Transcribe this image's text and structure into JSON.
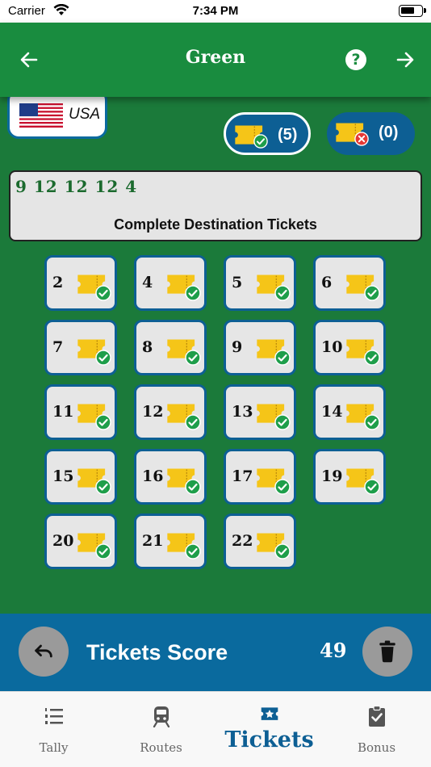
{
  "status_bar": {
    "carrier": "Carrier",
    "time": "7:34 PM"
  },
  "header": {
    "title": "Green"
  },
  "country": {
    "name": "USA"
  },
  "counts": {
    "completed": "(5)",
    "failed": "(0)"
  },
  "summary": {
    "sequence": "9  12  12  12  4",
    "caption": "Complete Destination Tickets"
  },
  "tickets": [
    "2",
    "4",
    "5",
    "6",
    "7",
    "8",
    "9",
    "10",
    "11",
    "12",
    "13",
    "14",
    "15",
    "16",
    "17",
    "19",
    "20",
    "21",
    "22"
  ],
  "score": {
    "label": "Tickets Score",
    "value": "49"
  },
  "tabs": [
    {
      "label": "Tally",
      "icon": "list-numbered-icon"
    },
    {
      "label": "Routes",
      "icon": "train-icon"
    },
    {
      "label": "Tickets",
      "icon": "star-ticket-icon"
    },
    {
      "label": "Bonus",
      "icon": "clipboard-check-icon"
    }
  ],
  "colors": {
    "green": "#1b7a3a",
    "header": "#198c3f",
    "blue": "#0d5f94",
    "ticket": "#f5c518",
    "check": "#1e9e4a",
    "cross": "#e53935"
  }
}
